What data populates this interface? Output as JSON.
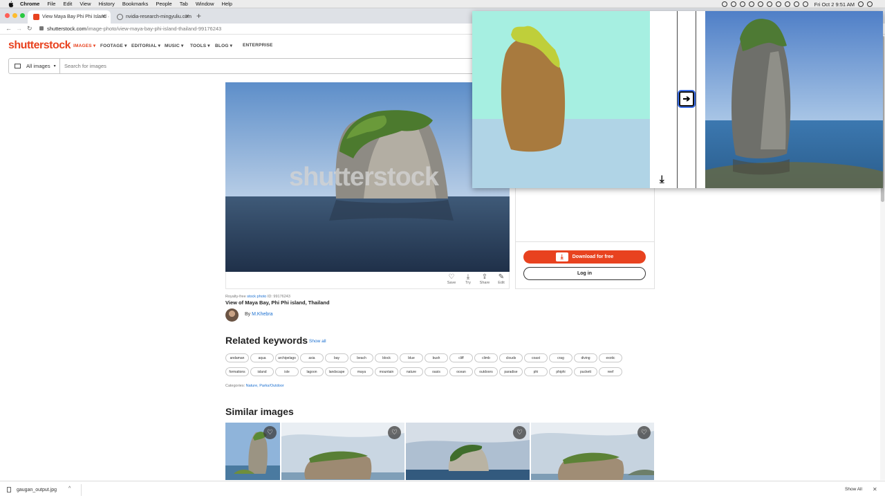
{
  "menubar": {
    "app": "Chrome",
    "items": [
      "File",
      "Edit",
      "View",
      "History",
      "Bookmarks",
      "People",
      "Tab",
      "Window",
      "Help"
    ],
    "clock": "Fri Oct 2  9:51 AM"
  },
  "browser": {
    "tabs": [
      {
        "title": "View Maya Bay Phi Phi Island ·"
      },
      {
        "title": "nvidia-research-mingyuliu.com"
      }
    ],
    "url_host": "shutterstock.com",
    "url_path": "/image-photo/view-maya-bay-phi-island-thailand-99176243"
  },
  "site": {
    "logo": "shutterstock",
    "nav": [
      "IMAGES",
      "FOOTAGE",
      "EDITORIAL",
      "MUSIC",
      "TOOLS",
      "BLOG",
      "ENTERPRISE"
    ],
    "filter_label": "All images",
    "search_placeholder": "Search for images"
  },
  "image": {
    "watermark": "shutterstock",
    "actions": [
      {
        "icon": "heart-icon",
        "label": "Save"
      },
      {
        "icon": "download-icon",
        "label": "Try"
      },
      {
        "icon": "share-icon",
        "label": "Share"
      },
      {
        "icon": "edit-icon",
        "label": "Edit"
      }
    ],
    "meta_prefix": "Royalty-free",
    "meta_link": "stock photo",
    "meta_id": "ID: 99176243",
    "title": "View of Maya Bay, Phi Phi island, Thailand",
    "by": "By",
    "author": "M.Khebra"
  },
  "panel": {
    "download_label": "Download for free",
    "login_label": "Log in"
  },
  "keywords": {
    "heading": "Related keywords",
    "show_all": "Show all",
    "row1": [
      "andaman",
      "aqua",
      "archipelago",
      "asia",
      "bay",
      "beach",
      "block",
      "blue",
      "bush",
      "cliff",
      "climb",
      "clouds",
      "coast",
      "crag",
      "diving",
      "exotic"
    ],
    "row2": [
      "formations",
      "island",
      "isle",
      "lagoon",
      "landscape",
      "maya",
      "mountain",
      "nature",
      "oasis",
      "ocean",
      "outdoors",
      "paradise",
      "phi",
      "phiphi",
      "puckett",
      "reef"
    ],
    "categories_label": "Categories:",
    "categories": "Nature, Parks/Outdoor"
  },
  "similar": {
    "heading": "Similar images"
  },
  "download_bar": {
    "file": "gaugan_output.jpg",
    "show_all": "Show All"
  },
  "colors": {
    "brand": "#e8421f",
    "link": "#1a6fd0",
    "canvas_sky": "#a6efe1",
    "canvas_sea": "#b0d4e6",
    "canvas_rock": "#a87a3e",
    "canvas_bush": "#bfcf3a"
  }
}
